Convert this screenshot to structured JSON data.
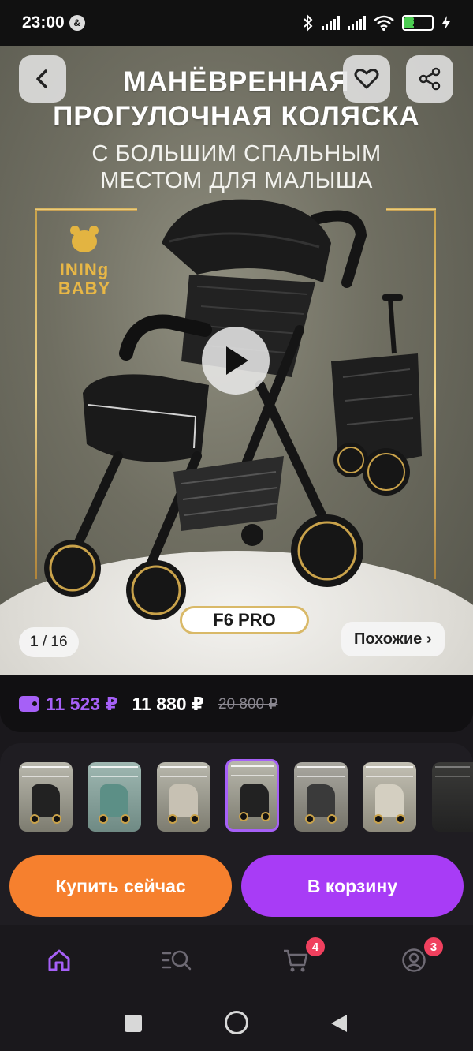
{
  "status_bar": {
    "time": "23:00",
    "notification_icon": "assistant-badge-icon",
    "battery_level": "21",
    "icons": [
      "bluetooth-icon",
      "signal-icon",
      "signal-icon",
      "wifi-icon",
      "battery-icon",
      "charging-icon"
    ]
  },
  "hero": {
    "title": "МАНЁВРЕННАЯ ПРОГУЛОЧНАЯ КОЛЯСКА",
    "subtitle": "С БОЛЬШИМ СПАЛЬНЫМ МЕСТОМ ДЛЯ МАЛЫША",
    "brand_line1": "ININg",
    "brand_line2": "BABY",
    "model": "F6 PRO",
    "counter_current": "1",
    "counter_total": "/ 16",
    "similar_label": "Похожие ›",
    "bg_colors": {
      "gold": "#d9b968",
      "backdrop": "#6f6e61"
    }
  },
  "price": {
    "wallet_price": "11 523 ₽",
    "price": "11 880 ₽",
    "old_price": "20 800 ₽",
    "accent": "#a660f7"
  },
  "thumbnails": {
    "count_visible": 7,
    "active_index": 3
  },
  "actions": {
    "buy_now": "Купить сейчас",
    "add_to_cart": "В корзину",
    "buy_color": "#f6802e",
    "cart_color": "#a83cf6"
  },
  "bottom_nav": {
    "items": [
      {
        "icon": "home-icon"
      },
      {
        "icon": "catalog-search-icon"
      },
      {
        "icon": "cart-icon",
        "badge": "4"
      },
      {
        "icon": "profile-icon",
        "badge": "3"
      }
    ]
  },
  "system_nav": {
    "icons": [
      "recents-icon",
      "home-circle-icon",
      "back-triangle-icon"
    ]
  }
}
